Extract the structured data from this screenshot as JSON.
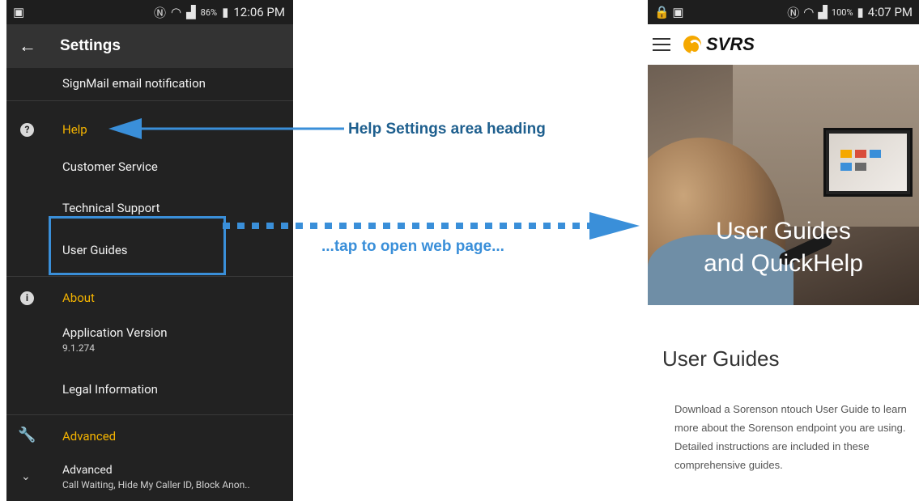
{
  "left_phone": {
    "status_bar": {
      "time": "12:06 PM",
      "battery": "86%"
    },
    "app_bar": {
      "title": "Settings"
    },
    "items": {
      "signmail": "SignMail email notification",
      "help_heading": "Help",
      "customer_service": "Customer Service",
      "technical_support": "Technical Support",
      "user_guides": "User Guides",
      "about_heading": "About",
      "app_version_label": "Application Version",
      "app_version_value": "9.1.274",
      "legal": "Legal Information",
      "advanced_heading": "Advanced",
      "advanced_title": "Advanced",
      "advanced_sub": "Call Waiting, Hide My Caller ID, Block Anon.."
    }
  },
  "annotations": {
    "heading_callout": "Help Settings area heading",
    "tap_callout": "...tap to open web page..."
  },
  "right_phone": {
    "status_bar": {
      "time": "4:07 PM",
      "battery": "100%"
    },
    "logo": "SVRS",
    "hero_title_line1": "User Guides",
    "hero_title_line2": "and QuickHelp",
    "section_heading": "User Guides",
    "paragraph": "Download a Sorenson ntouch User Guide to learn more about the Sorenson endpoint you are using. Detailed instructions are included in these comprehensive guides."
  },
  "colors": {
    "accent": "#f5b400",
    "annotation_blue": "#3a8fd9",
    "annotation_dark_blue": "#1e5f8e"
  }
}
